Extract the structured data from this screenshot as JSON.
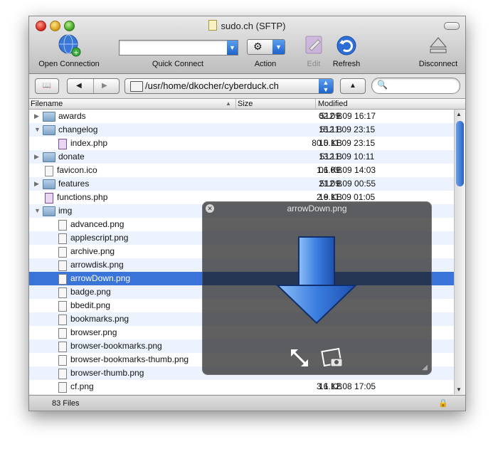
{
  "window": {
    "title": "sudo.ch (SFTP)"
  },
  "toolbar": {
    "open_connection": "Open Connection",
    "quick_connect": "Quick Connect",
    "action": "Action",
    "edit": "Edit",
    "refresh": "Refresh",
    "disconnect": "Disconnect"
  },
  "navbar": {
    "path": "/usr/home/dkocher/cyberduck.ch"
  },
  "columns": {
    "filename": "Filename",
    "size": "Size",
    "modified": "Modified"
  },
  "files": [
    {
      "name": "awards",
      "type": "folder",
      "level": 0,
      "disclosure": "collapsed",
      "size": "512 B",
      "modified": "02.09.09 16:17"
    },
    {
      "name": "changelog",
      "type": "folder",
      "level": 0,
      "disclosure": "expanded",
      "size": "512 B",
      "modified": "15.11.09 23:15"
    },
    {
      "name": "index.php",
      "type": "php",
      "level": 1,
      "size": "80.0 KB",
      "modified": "15.11.09 23:15"
    },
    {
      "name": "donate",
      "type": "folder",
      "level": 0,
      "disclosure": "collapsed",
      "size": "512 B",
      "modified": "13.11.09 10:11"
    },
    {
      "name": "favicon.ico",
      "type": "file",
      "level": 0,
      "size": "1.1 KB",
      "modified": "06.09.09 14:03"
    },
    {
      "name": "features",
      "type": "folder",
      "level": 0,
      "disclosure": "collapsed",
      "size": "512 B",
      "modified": "21.09.09 00:55"
    },
    {
      "name": "functions.php",
      "type": "php",
      "level": 0,
      "size": "2.9 KB",
      "modified": "16.11.09 01:05"
    },
    {
      "name": "img",
      "type": "folder",
      "level": 0,
      "disclosure": "expanded",
      "size": "",
      "modified": ""
    },
    {
      "name": "advanced.png",
      "type": "png",
      "level": 1,
      "size": "",
      "modified": ""
    },
    {
      "name": "applescript.png",
      "type": "png",
      "level": 1,
      "size": "",
      "modified": ""
    },
    {
      "name": "archive.png",
      "type": "png",
      "level": 1,
      "size": "",
      "modified": ""
    },
    {
      "name": "arrowdisk.png",
      "type": "png",
      "level": 1,
      "size": "",
      "modified": ""
    },
    {
      "name": "arrowDown.png",
      "type": "png",
      "level": 1,
      "size": "",
      "modified": "",
      "selected": true
    },
    {
      "name": "badge.png",
      "type": "png",
      "level": 1,
      "size": "",
      "modified": ""
    },
    {
      "name": "bbedit.png",
      "type": "png",
      "level": 1,
      "size": "",
      "modified": ""
    },
    {
      "name": "bookmarks.png",
      "type": "png",
      "level": 1,
      "size": "",
      "modified": ""
    },
    {
      "name": "browser.png",
      "type": "png",
      "level": 1,
      "size": "",
      "modified": ""
    },
    {
      "name": "browser-bookmarks.png",
      "type": "png",
      "level": 1,
      "size": "",
      "modified": ""
    },
    {
      "name": "browser-bookmarks-thumb.png",
      "type": "png",
      "level": 1,
      "size": "",
      "modified": ""
    },
    {
      "name": "browser-thumb.png",
      "type": "png",
      "level": 1,
      "size": "",
      "modified": ""
    },
    {
      "name": "cf.png",
      "type": "png",
      "level": 1,
      "size": "3.1 KB",
      "modified": "16.12.08 17:05"
    }
  ],
  "status": {
    "count": "83 Files"
  },
  "quicklook": {
    "title": "arrowDown.png"
  }
}
